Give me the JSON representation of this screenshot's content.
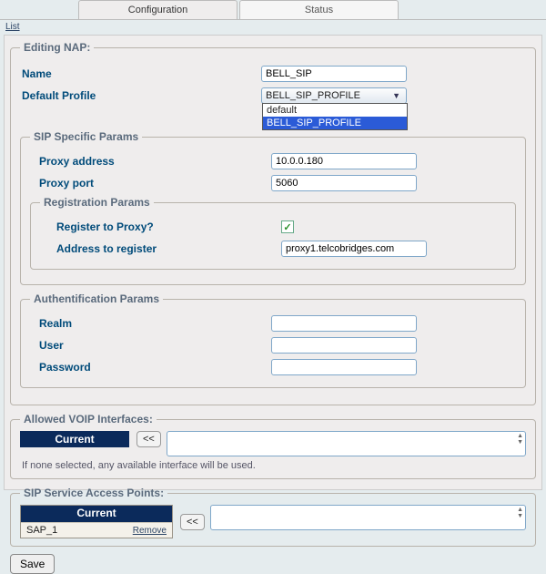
{
  "tabs": {
    "configuration": "Configuration",
    "status": "Status"
  },
  "toolbar": {
    "list": "List"
  },
  "editing_legend": "Editing NAP:",
  "name_label": "Name",
  "name_value": "BELL_SIP",
  "default_profile_label": "Default Profile",
  "default_profile_selected": "BELL_SIP_PROFILE",
  "default_profile_options": {
    "opt0": "default",
    "opt1": "BELL_SIP_PROFILE"
  },
  "sip_legend": "SIP Specific Params",
  "proxy_address_label": "Proxy address",
  "proxy_address_value": "10.0.0.180",
  "proxy_port_label": "Proxy port",
  "proxy_port_value": "5060",
  "reg_legend": "Registration Params",
  "register_label": "Register to Proxy?",
  "register_checked": true,
  "address_register_label": "Address to register",
  "address_register_value": "proxy1.telcobridges.com",
  "auth_legend": "Authentification Params",
  "realm_label": "Realm",
  "realm_value": "",
  "user_label": "User",
  "user_value": "",
  "password_label": "Password",
  "password_value": "",
  "allowed_legend": "Allowed VOIP Interfaces:",
  "allowed_current": "Current",
  "allowed_move": "<<",
  "allowed_note": "If none selected, any available interface will be used.",
  "sap_legend": "SIP Service Access Points:",
  "sap_current": "Current",
  "sap_item": "SAP_1",
  "sap_remove": "Remove",
  "sap_move": "<<",
  "save_label": "Save"
}
